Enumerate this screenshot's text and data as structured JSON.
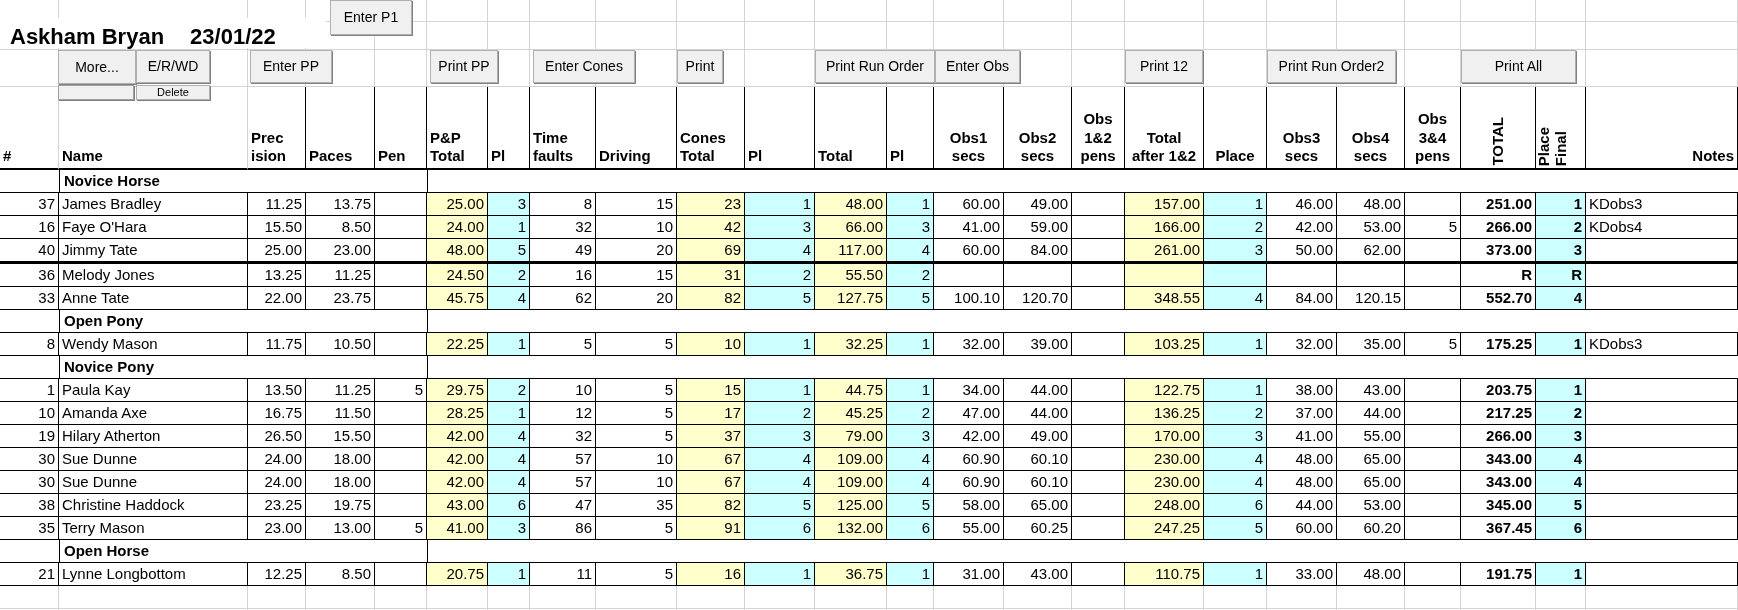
{
  "title": "Askham Bryan",
  "date": "23/01/22",
  "buttons": [
    {
      "label": "Enter P1"
    },
    {
      "label": "More..."
    },
    {
      "label": "E/R/WD"
    },
    {
      "label": "Enter PP"
    },
    {
      "label": "Print PP"
    },
    {
      "label": "Enter Cones"
    },
    {
      "label": "Print"
    },
    {
      "label": "Print Run Order"
    },
    {
      "label": "Enter Obs"
    },
    {
      "label": "Print 12"
    },
    {
      "label": "Print Run Order2"
    },
    {
      "label": "Print All"
    },
    {
      "label": "Delete"
    }
  ],
  "columns": [
    {
      "header": "#"
    },
    {
      "header": "Name"
    },
    {
      "header": "Prec\nision"
    },
    {
      "header": "Paces"
    },
    {
      "header": "Pen"
    },
    {
      "header": "P&P\nTotal",
      "color": "#ffffcc"
    },
    {
      "header": "Pl",
      "color": "#ccffff"
    },
    {
      "header": "Time\nfaults"
    },
    {
      "header": "Driving"
    },
    {
      "header": "Cones\nTotal",
      "color": "#ffffcc"
    },
    {
      "header": "Pl",
      "color": "#ccffff"
    },
    {
      "header": "Total",
      "color": "#ffffcc"
    },
    {
      "header": "Pl",
      "color": "#ccffff"
    },
    {
      "header": "Obs1\nsecs"
    },
    {
      "header": "Obs2\nsecs"
    },
    {
      "header": "Obs\n1&2\npens"
    },
    {
      "header": "Total\nafter 1&2",
      "color": "#ffffcc"
    },
    {
      "header": "Place",
      "color": "#ccffff"
    },
    {
      "header": "Obs3\nsecs"
    },
    {
      "header": "Obs4\nsecs"
    },
    {
      "header": "Obs\n3&4\npens"
    },
    {
      "header": "TOTAL",
      "vertical": true,
      "bold": true
    },
    {
      "header": "Place\nFinal",
      "vertical": true,
      "bold": true,
      "color": "#ccffff"
    },
    {
      "header": "Notes"
    }
  ],
  "rows": [
    {
      "kind": "group",
      "label": "Novice Horse"
    },
    {
      "kind": "entry",
      "cells": [
        "37",
        "James Bradley",
        "11.25",
        "13.75",
        null,
        "25.00",
        "3",
        "8",
        "15",
        "23",
        "1",
        "48.00",
        "1",
        "60.00",
        "49.00",
        null,
        "157.00",
        "1",
        "46.00",
        "48.00",
        null,
        "251.00",
        "1",
        "KDobs3"
      ]
    },
    {
      "kind": "entry",
      "cells": [
        "16",
        "Faye O'Hara",
        "15.50",
        "8.50",
        null,
        "24.00",
        "1",
        "32",
        "10",
        "42",
        "3",
        "66.00",
        "3",
        "41.00",
        "59.00",
        null,
        "166.00",
        "2",
        "42.00",
        "53.00",
        "5",
        "266.00",
        "2",
        "KDobs4"
      ]
    },
    {
      "kind": "entry",
      "rule_below": true,
      "cells": [
        "40",
        "Jimmy Tate",
        "25.00",
        "23.00",
        null,
        "48.00",
        "5",
        "49",
        "20",
        "69",
        "4",
        "117.00",
        "4",
        "60.00",
        "84.00",
        null,
        "261.00",
        "3",
        "50.00",
        "62.00",
        null,
        "373.00",
        "3",
        null
      ]
    },
    {
      "kind": "entry",
      "cells": [
        "36",
        "Melody Jones",
        "13.25",
        "11.25",
        null,
        "24.50",
        "2",
        "16",
        "15",
        "31",
        "2",
        "55.50",
        "2",
        null,
        null,
        null,
        null,
        null,
        null,
        null,
        null,
        "R",
        "R",
        null
      ]
    },
    {
      "kind": "entry",
      "cells": [
        "33",
        "Anne Tate",
        "22.00",
        "23.75",
        null,
        "45.75",
        "4",
        "62",
        "20",
        "82",
        "5",
        "127.75",
        "5",
        "100.10",
        "120.70",
        null,
        "348.55",
        "4",
        "84.00",
        "120.15",
        null,
        "552.70",
        "4",
        null
      ]
    },
    {
      "kind": "group",
      "label": "Open Pony"
    },
    {
      "kind": "entry",
      "cells": [
        "8",
        "Wendy Mason",
        "11.75",
        "10.50",
        null,
        "22.25",
        "1",
        "5",
        "5",
        "10",
        "1",
        "32.25",
        "1",
        "32.00",
        "39.00",
        null,
        "103.25",
        "1",
        "32.00",
        "35.00",
        "5",
        "175.25",
        "1",
        "KDobs3"
      ]
    },
    {
      "kind": "group",
      "label": "Novice Pony"
    },
    {
      "kind": "entry",
      "cells": [
        "1",
        "Paula Kay",
        "13.50",
        "11.25",
        "5",
        "29.75",
        "2",
        "10",
        "5",
        "15",
        "1",
        "44.75",
        "1",
        "34.00",
        "44.00",
        null,
        "122.75",
        "1",
        "38.00",
        "43.00",
        null,
        "203.75",
        "1",
        null
      ]
    },
    {
      "kind": "entry",
      "cells": [
        "10",
        "Amanda Axe",
        "16.75",
        "11.50",
        null,
        "28.25",
        "1",
        "12",
        "5",
        "17",
        "2",
        "45.25",
        "2",
        "47.00",
        "44.00",
        null,
        "136.25",
        "2",
        "37.00",
        "44.00",
        null,
        "217.25",
        "2",
        null
      ]
    },
    {
      "kind": "entry",
      "cells": [
        "19",
        "Hilary Atherton",
        "26.50",
        "15.50",
        null,
        "42.00",
        "4",
        "32",
        "5",
        "37",
        "3",
        "79.00",
        "3",
        "42.00",
        "49.00",
        null,
        "170.00",
        "3",
        "41.00",
        "55.00",
        null,
        "266.00",
        "3",
        null
      ]
    },
    {
      "kind": "entry",
      "cells": [
        "30",
        "Sue Dunne",
        "24.00",
        "18.00",
        null,
        "42.00",
        "4",
        "57",
        "10",
        "67",
        "4",
        "109.00",
        "4",
        "60.90",
        "60.10",
        null,
        "230.00",
        "4",
        "48.00",
        "65.00",
        null,
        "343.00",
        "4",
        null
      ]
    },
    {
      "kind": "entry",
      "cells": [
        "30",
        "Sue Dunne",
        "24.00",
        "18.00",
        null,
        "42.00",
        "4",
        "57",
        "10",
        "67",
        "4",
        "109.00",
        "4",
        "60.90",
        "60.10",
        null,
        "230.00",
        "4",
        "48.00",
        "65.00",
        null,
        "343.00",
        "4",
        null
      ]
    },
    {
      "kind": "entry",
      "cells": [
        "38",
        "Christine Haddock",
        "23.25",
        "19.75",
        null,
        "43.00",
        "6",
        "47",
        "35",
        "82",
        "5",
        "125.00",
        "5",
        "58.00",
        "65.00",
        null,
        "248.00",
        "6",
        "44.00",
        "53.00",
        null,
        "345.00",
        "5",
        null
      ]
    },
    {
      "kind": "entry",
      "cells": [
        "35",
        "Terry Mason",
        "23.00",
        "13.00",
        "5",
        "41.00",
        "3",
        "86",
        "5",
        "91",
        "6",
        "132.00",
        "6",
        "55.00",
        "60.25",
        null,
        "247.25",
        "5",
        "60.00",
        "60.20",
        null,
        "367.45",
        "6",
        null
      ]
    },
    {
      "kind": "group",
      "label": "Open Horse"
    },
    {
      "kind": "entry",
      "cells": [
        "21",
        "Lynne Longbottom",
        "12.25",
        "8.50",
        null,
        "20.75",
        "1",
        "11",
        "5",
        "16",
        "1",
        "36.75",
        "1",
        "31.00",
        "43.00",
        null,
        "110.75",
        "1",
        "33.00",
        "48.00",
        null,
        "191.75",
        "1",
        null
      ]
    }
  ]
}
